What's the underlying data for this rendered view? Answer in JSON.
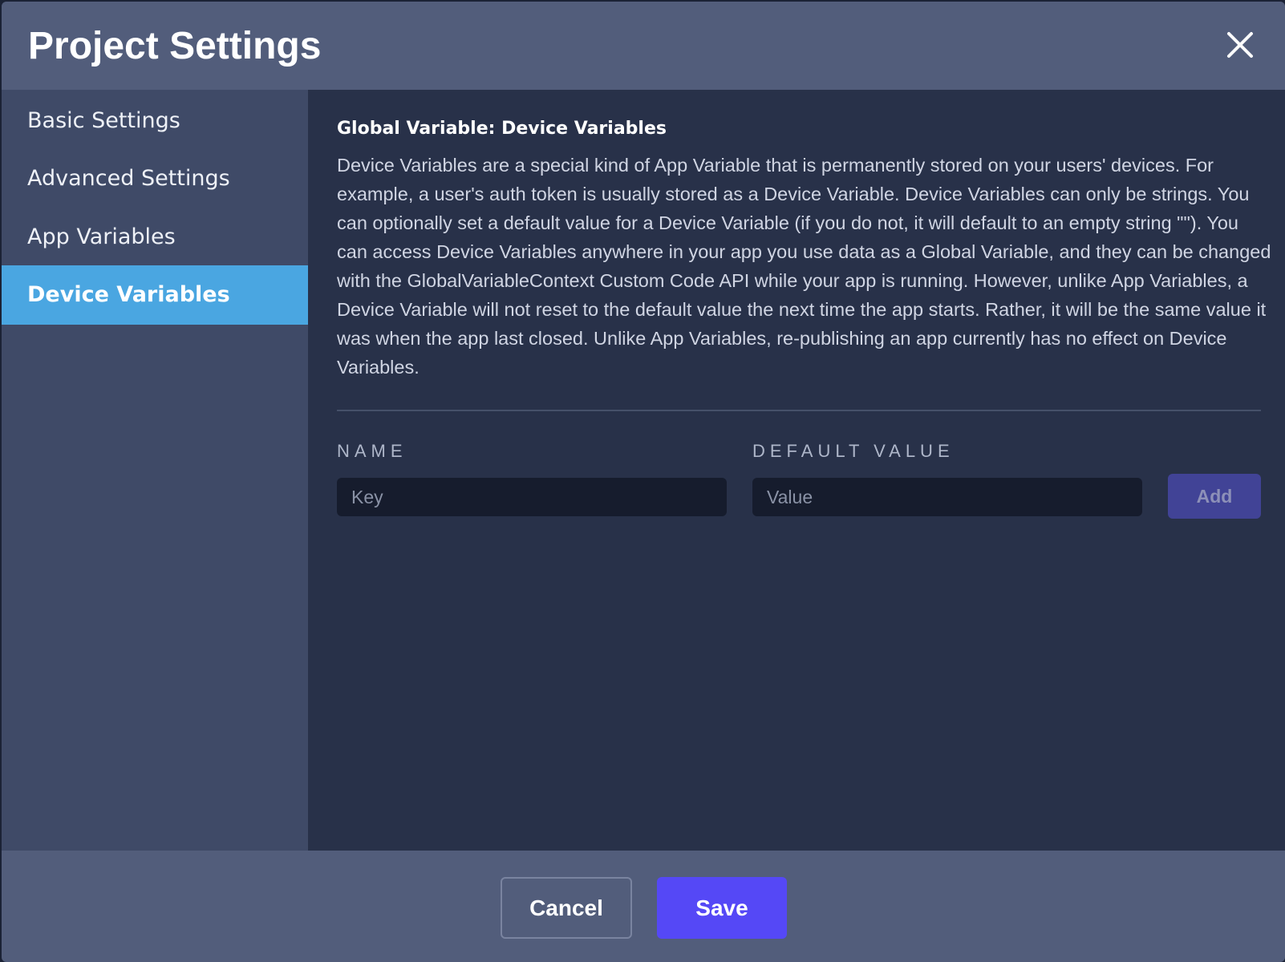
{
  "header": {
    "title": "Project Settings"
  },
  "sidebar": {
    "items": [
      {
        "label": "Basic Settings",
        "active": false
      },
      {
        "label": "Advanced Settings",
        "active": false
      },
      {
        "label": "App Variables",
        "active": false
      },
      {
        "label": "Device Variables",
        "active": true
      }
    ]
  },
  "main": {
    "section_title": "Global Variable: Device Variables",
    "description": "Device Variables are a special kind of App Variable that is permanently stored on your users' devices. For example, a user's auth token is usually stored as a Device Variable. Device Variables can only be strings. You can optionally set a default value for a Device Variable (if you do not, it will default to an empty string \"\"). You can access Device Variables anywhere in your app you use data as a Global Variable, and they can be changed with the GlobalVariableContext Custom Code API while your app is running. However, unlike App Variables, a Device Variable will not reset to the default value the next time the app starts. Rather, it will be the same value it was when the app last closed. Unlike App Variables, re-publishing an app currently has no effect on Device Variables.",
    "name_label": "NAME",
    "default_value_label": "DEFAULT VALUE",
    "key_input": {
      "value": "",
      "placeholder": "Key"
    },
    "value_input": {
      "value": "",
      "placeholder": "Value"
    },
    "add_label": "Add"
  },
  "footer": {
    "cancel_label": "Cancel",
    "save_label": "Save"
  },
  "colors": {
    "header_bg": "#525d7b",
    "sidebar_bg": "#3f4a67",
    "content_bg": "#283149",
    "active_nav": "#4aa6e1",
    "save_button": "#5548f6",
    "add_button": "#414396"
  },
  "icons": {
    "close": "close-icon"
  }
}
